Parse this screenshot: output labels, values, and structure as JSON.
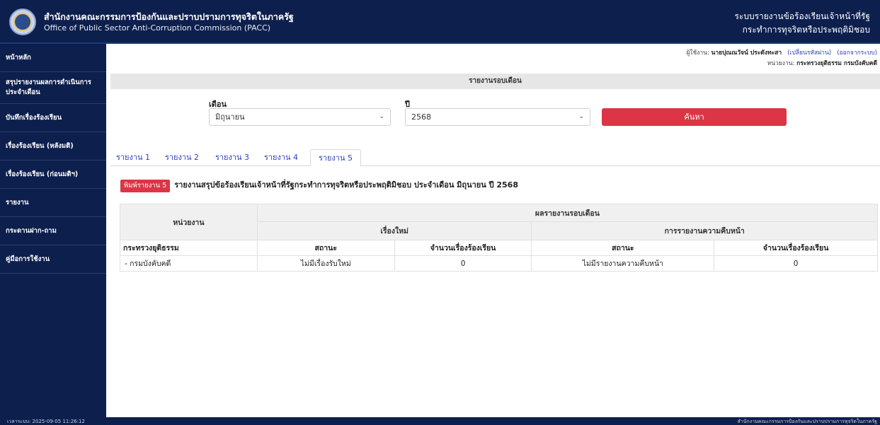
{
  "header": {
    "org_th": "สำนักงานคณะกรรมการป้องกันและปราบปรามการทุจริตในภาครัฐ",
    "org_en": "Office of Public Sector Anti-Corruption Commission (PACC)",
    "system_line1": "ระบบรายงานข้อร้องเรียนเจ้าหน้าที่รัฐ",
    "system_line2": "กระทำการทุจริตหรือประพฤติมิชอบ"
  },
  "sidebar": {
    "items": [
      {
        "label": "หน้าหลัก"
      },
      {
        "label": "สรุปรายงานผลการดำเนินการประจำเดือน"
      },
      {
        "label": "บันทึกเรื่องร้องเรียน"
      },
      {
        "label": "เรื่องร้องเรียน (หลังมติ)"
      },
      {
        "label": "เรื่องร้องเรียน (ก่อนมติฯ)"
      },
      {
        "label": "รายงาน"
      },
      {
        "label": "กระดานฝาก-ถาม"
      },
      {
        "label": "คู่มือการใช้งาน"
      }
    ]
  },
  "user": {
    "user_label": "ผู้ใช้งาน:",
    "user_name": "นายปุณณวัจน์ ประดังทะสา",
    "change_password": "(เปลี่ยนรหัสผ่าน)",
    "logout": "(ออกจากระบบ)",
    "unit_label": "หน่วยงาน:",
    "unit_name": "กระทรวงยุติธรรม กรมบังคับคดี"
  },
  "filter": {
    "section_title": "รายงานรอบเดือน",
    "month_label": "เดือน",
    "month_value": "มิถุนายน",
    "year_label": "ปี",
    "year_value": "2568",
    "search_button": "ค้นหา"
  },
  "tabs": [
    "รายงาน 1",
    "รายงาน 2",
    "รายงาน 3",
    "รายงาน 4",
    "รายงาน 5"
  ],
  "active_tab": "รายงาน 5",
  "report": {
    "print_button": "พิมพ์รายงาน 5",
    "title": "รายงานสรุปข้อร้องเรียนเจ้าหน้าที่รัฐกระทำการทุจริตหรือประพฤติมิชอบ ประจำเดือน มิถุนายน ปี 2568"
  },
  "table": {
    "col_unit": "หน่วยงาน",
    "col_monthly_result": "ผลรายงานรอบเดือน",
    "col_new": "เรื่องใหม่",
    "col_progress": "การรายงานความคืบหน้า",
    "col_status": "สถานะ",
    "col_count": "จำนวนเรื่องร้องเรียน",
    "ministry": "กระทรวงยุติธรรม",
    "rows": [
      {
        "unit": "- กรมบังคับคดี",
        "new_status": "ไม่มีเรื่องรับใหม่",
        "new_count": "0",
        "progress_status": "ไม่มีรายงานความคืบหน้า",
        "progress_count": "0"
      }
    ]
  },
  "footer": {
    "left": "เวลาระบบ: 2025-09-05 11:26:12",
    "right": "สำนักงานคณะกรรมการป้องกันและปราบปรามการทุจริตในภาครัฐ"
  }
}
